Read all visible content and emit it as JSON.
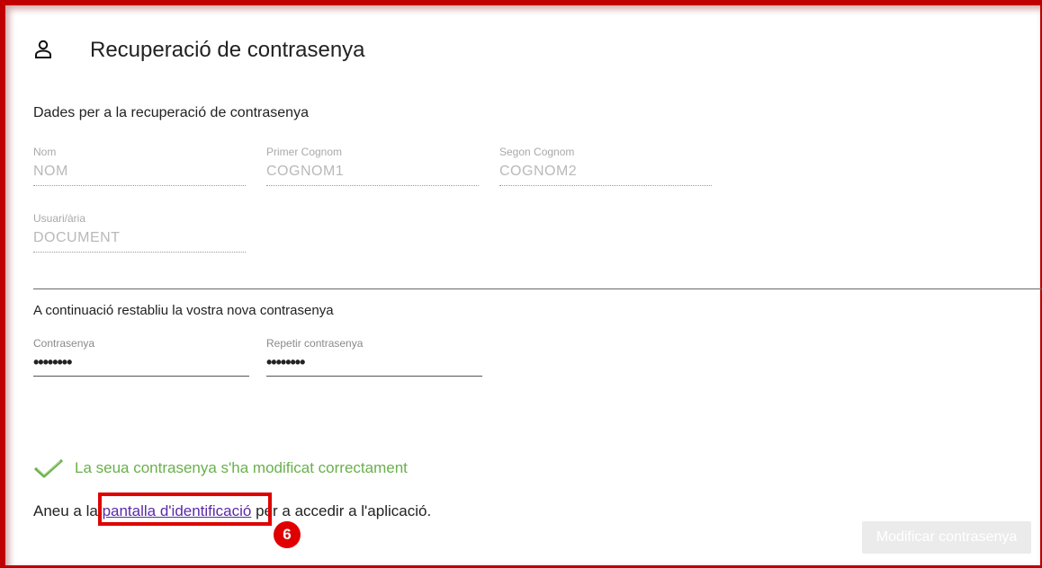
{
  "header": {
    "title": "Recuperació de contrasenya",
    "icon": "user-icon"
  },
  "recovery": {
    "heading": "Dades per a la recuperació de contrasenya",
    "fields": {
      "nom": {
        "label": "Nom",
        "value": "NOM"
      },
      "primer_cognom": {
        "label": "Primer Cognom",
        "value": "COGNOM1"
      },
      "segon_cognom": {
        "label": "Segon Cognom",
        "value": "COGNOM2"
      },
      "usuari": {
        "label": "Usuari/ària",
        "value": "DOCUMENT"
      }
    }
  },
  "new_password": {
    "heading": "A continuació restabliu la vostra nova contrasenya",
    "password": {
      "label": "Contrasenya",
      "value": "••••••••"
    },
    "repeat": {
      "label": "Repetir contrasenya",
      "value": "••••••••"
    }
  },
  "status": {
    "message": "La seua contrasenya s'ha modificat correctament",
    "icon": "check-icon",
    "color": "#6ab04c"
  },
  "navigation": {
    "prefix": "Aneu a la ",
    "link": "pantalla d'identificació",
    "suffix": " per a accedir a l'aplicació."
  },
  "annotation": {
    "step": "6",
    "color": "#e00000"
  },
  "actions": {
    "modify_label": "Modificar contrasenya"
  }
}
